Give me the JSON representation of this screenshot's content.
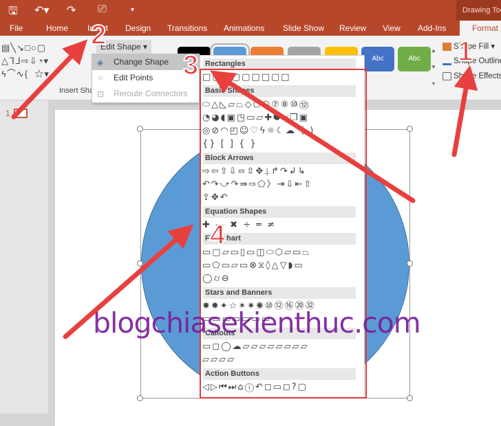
{
  "titlebar": {
    "context_tab": "Drawing Tools",
    "icons": [
      "save-icon",
      "undo-icon",
      "redo-icon",
      "slideshow-icon",
      "customize-icon"
    ]
  },
  "tabs": [
    "File",
    "Home",
    "Insert",
    "Design",
    "Transitions",
    "Animations",
    "Slide Show",
    "Review",
    "View",
    "Add-Ins",
    "Format"
  ],
  "active_tab": "Format",
  "ribbon": {
    "insert_shapes_label": "Insert Sha",
    "edit_shape_label": "Edit Shape ▾",
    "shape_styles": [
      {
        "color": "#000000",
        "label": ""
      },
      {
        "color": "#5b9bd5",
        "label": ""
      },
      {
        "color": "#ed7d31",
        "label": ""
      },
      {
        "color": "#a5a5a5",
        "label": ""
      },
      {
        "color": "#ffc000",
        "label": ""
      },
      {
        "color": "#4472c4",
        "label": "Abc"
      },
      {
        "color": "#70ad47",
        "label": "Abc"
      }
    ],
    "shape_fill": "Shape Fill ▾",
    "shape_outline": "Shape Outline",
    "shape_effects": "Shape Effects"
  },
  "edit_shape_menu": [
    {
      "label": "Change Shape",
      "state": "highlighted"
    },
    {
      "label": "Edit Points",
      "state": "normal"
    },
    {
      "label": "Reroute Connectors",
      "state": "disabled"
    }
  ],
  "gallery": {
    "sections": [
      "Rectangles",
      "Basic Shapes",
      "Block Arrows",
      "Equation Shapes",
      "Flowchart",
      "Stars and Banners",
      "Callouts",
      "Action Buttons"
    ],
    "rows": {
      "rect": [
        "□▢□▢▢□□▢□"
      ],
      "basic": [
        "⬭△◺▱⏢◇⬠⬡⑦⑧⑩⑫",
        "◔◕◖▣◳▭▱✚⯃⌭❒▣",
        "◎⊘◠◰☺♡ϟ☼☾☁◝( )",
        "{} [ ] { }"
      ],
      "arrows": [
        "⇨⇦⇧⇩⬄⇳✥⍊↱↷↲↳",
        "↶↷⤻↷⇛⇨⬠〉⇥⇩⇤⇧",
        "⇪✥↶"
      ],
      "equation": [
        "✚ — ✖ ÷ ═ ≠"
      ],
      "flow": [
        "▭▢▱▭▯▭◫⬭⬡▱▭⏢",
        "▭⬠▭▱▭⊗⧖◊△▽◗▭",
        "◯⌭⊖"
      ],
      "stars": [
        "✸✹✦☆✶✷✺⑩⑫⑯⑳㉜",
        "▭▭▭▭▭▭▭"
      ],
      "callouts": [
        "▭◻◯☁▱▱▱▱▱▱▱▱",
        "▱▱▱▱"
      ],
      "actions": [
        "◁▷⏮⏭⌂ⓘ↶◻▭◻?▢"
      ]
    }
  },
  "slide_number": "1",
  "shape_color": "#5b9bd5",
  "accent": "#b7472a",
  "annotations": [
    "1",
    "2",
    "3",
    "4"
  ],
  "watermark": "blogchiasekienthuc.com"
}
